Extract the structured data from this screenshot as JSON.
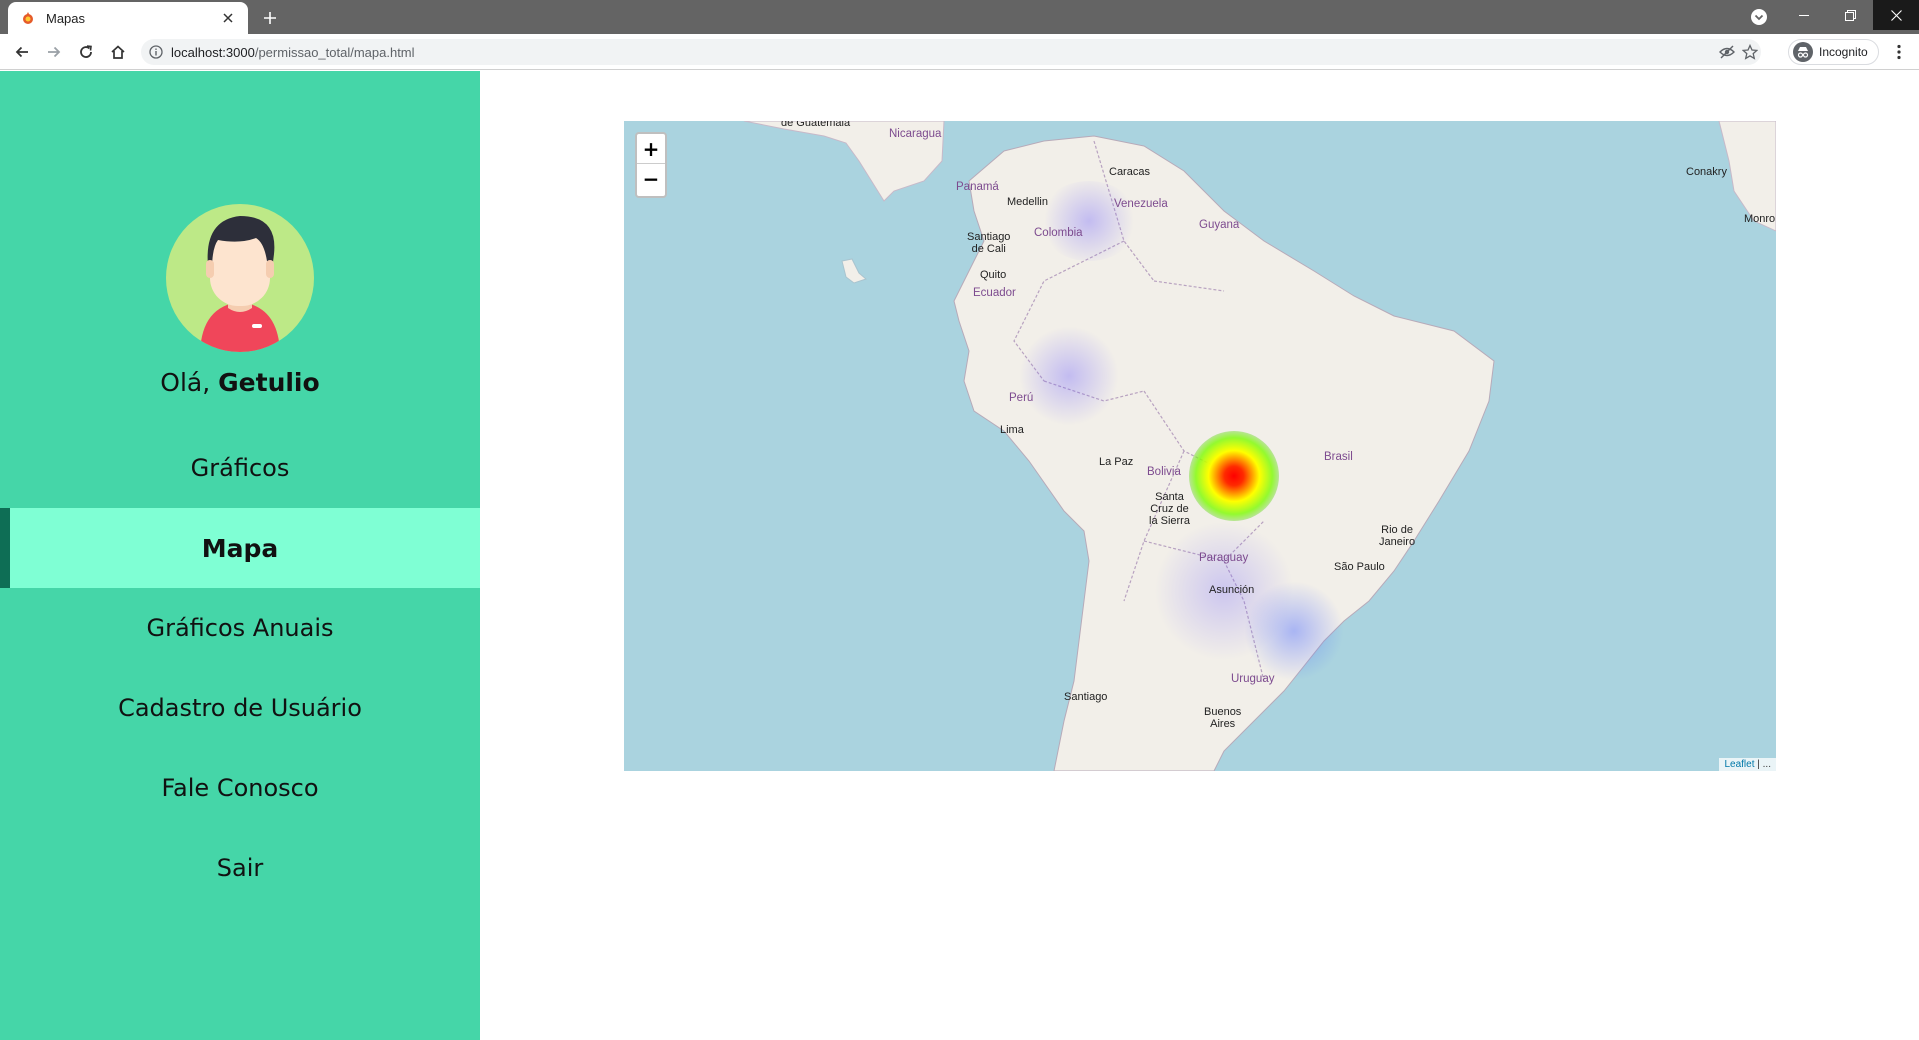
{
  "browser": {
    "tab_title": "Mapas",
    "url_host": "localhost:3000",
    "url_path": "/permissao_total/mapa.html",
    "incognito_label": "Incognito"
  },
  "sidebar": {
    "greeting_prefix": "Olá,",
    "user_name": "Getulio",
    "items": [
      {
        "label": "Gráficos",
        "active": false
      },
      {
        "label": "Mapa",
        "active": true
      },
      {
        "label": "Gráficos Anuais",
        "active": false
      },
      {
        "label": "Cadastro de Usuário",
        "active": false
      },
      {
        "label": "Fale Conosco",
        "active": false
      },
      {
        "label": "Sair",
        "active": false
      }
    ]
  },
  "map": {
    "zoom_in": "+",
    "zoom_out": "−",
    "attribution_link": "Leaflet",
    "attribution_rest": " | ...",
    "labels": {
      "guatemala": "de Guatemala",
      "nicaragua": "Nicaragua",
      "panama": "Panamá",
      "caracas": "Caracas",
      "medellin": "Medellin",
      "venezuela": "Venezuela",
      "guyana": "Guyana",
      "santiago_cali_1": "Santiago",
      "santiago_cali_2": "de Cali",
      "colombia": "Colombia",
      "quito": "Quito",
      "ecuador": "Ecuador",
      "peru": "Perú",
      "lima": "Lima",
      "la_paz": "La Paz",
      "bolivia": "Bolivia",
      "santa_cruz_1": "Santa",
      "santa_cruz_2": "Cruz de",
      "santa_cruz_3": "la Sierra",
      "brasil": "Brasil",
      "rio_1": "Rio de",
      "rio_2": "Janeiro",
      "sao_paulo": "São Paulo",
      "paraguay": "Paraguay",
      "asuncion": "Asunción",
      "uruguay": "Uruguay",
      "santiago": "Santiago",
      "buenos_aires_1": "Buenos",
      "buenos_aires_2": "Aires",
      "conakry": "Conakry",
      "monrovia": "Monro"
    },
    "heat_colors": {
      "core": "#ff0000",
      "mid": "#ffff00",
      "outer": "#7cfc00",
      "low": "#6a5cff"
    }
  }
}
